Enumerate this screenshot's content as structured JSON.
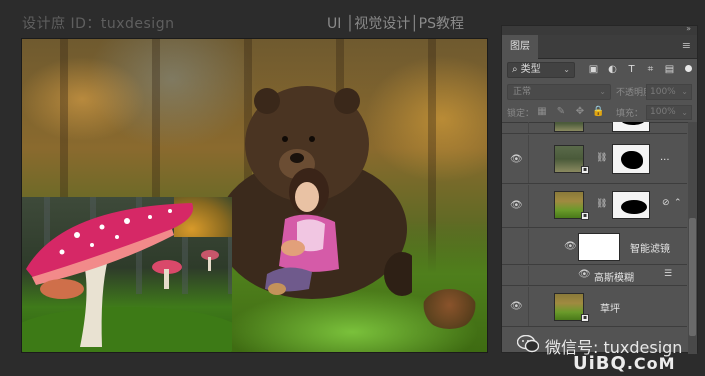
{
  "watermark": {
    "left": "设计庶 ID：tuxdesign",
    "right": "UI │视觉设计│PS教程"
  },
  "layers_panel": {
    "tab": "图层",
    "filter_kind": "类型",
    "filter_icons": [
      "image-filter-icon",
      "adjustment-filter-icon",
      "type-filter-icon",
      "shape-filter-icon",
      "smartobject-filter-icon"
    ],
    "blend_mode": "正常",
    "opacity_label": "不透明度：",
    "opacity_value": "100%",
    "lock_label": "锁定：",
    "fill_label": "填充：",
    "fill_value": "100%",
    "layers": [
      {
        "name": "",
        "visible": false
      },
      {
        "name": "",
        "visible": true,
        "ellipsis": "..."
      },
      {
        "name": "",
        "visible": true,
        "selected": false
      },
      {
        "name": "智能滤镜",
        "visible": true
      },
      {
        "name": "高斯模糊",
        "visible": true
      },
      {
        "name": "草坪",
        "visible": true
      }
    ]
  },
  "brand": {
    "wechat": "微信号: tuxdesign",
    "site_ui": "UiBQ",
    "site_com": ".CoM"
  }
}
